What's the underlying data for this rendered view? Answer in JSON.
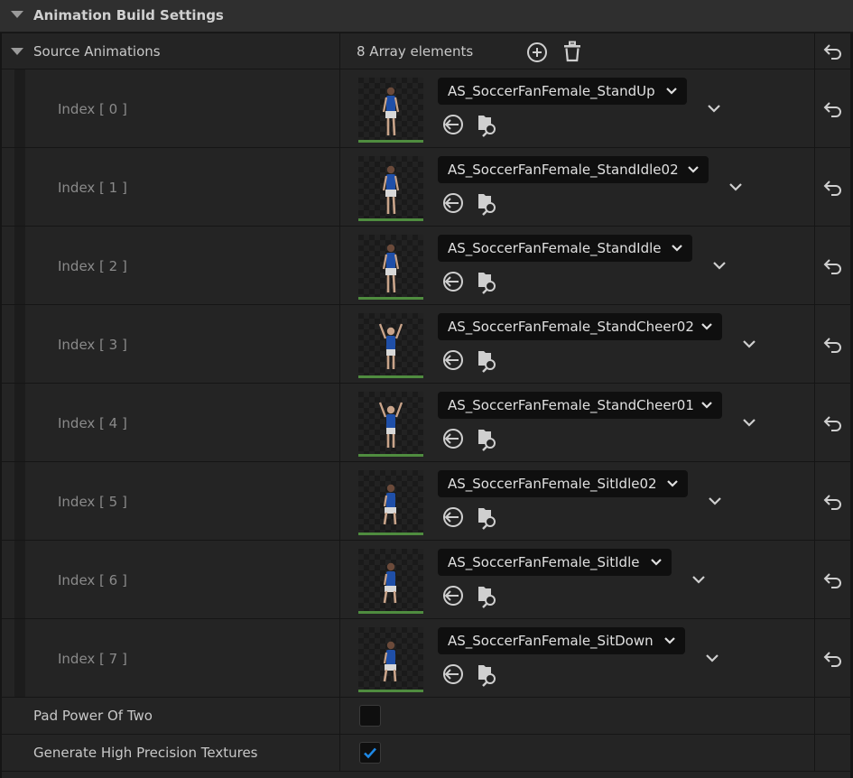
{
  "section": {
    "title": "Animation Build Settings",
    "expand_icon": "triangle-down-icon"
  },
  "source_animations": {
    "label": "Source Animations",
    "count_text": "8 Array elements",
    "add_icon": "plus-circle-icon",
    "delete_icon": "trash-icon",
    "reset_icon": "undo-arrow-icon",
    "items": [
      {
        "index_label": "Index [ 0 ]",
        "asset": "AS_SoccerFanFemale_StandUp"
      },
      {
        "index_label": "Index [ 1 ]",
        "asset": "AS_SoccerFanFemale_StandIdle02"
      },
      {
        "index_label": "Index [ 2 ]",
        "asset": "AS_SoccerFanFemale_StandIdle"
      },
      {
        "index_label": "Index [ 3 ]",
        "asset": "AS_SoccerFanFemale_StandCheer02"
      },
      {
        "index_label": "Index [ 4 ]",
        "asset": "AS_SoccerFanFemale_StandCheer01"
      },
      {
        "index_label": "Index [ 5 ]",
        "asset": "AS_SoccerFanFemale_SitIdle02"
      },
      {
        "index_label": "Index [ 6 ]",
        "asset": "AS_SoccerFanFemale_SitIdle"
      },
      {
        "index_label": "Index [ 7 ]",
        "asset": "AS_SoccerFanFemale_SitDown"
      }
    ],
    "item_icons": {
      "use_selected": "use-selected-arrow-icon",
      "browse": "browse-folder-icon",
      "combo": "chevron-down-icon",
      "thumbnail": "character-thumbnail"
    }
  },
  "pad_power_of_two": {
    "label": "Pad Power Of Two",
    "checked": false
  },
  "high_precision": {
    "label": "Generate High Precision Textures",
    "checked": true
  },
  "colors": {
    "accent": "#1e88e5",
    "thumb_bar": "#4f8c3f",
    "jersey": "#1f4fa8"
  }
}
